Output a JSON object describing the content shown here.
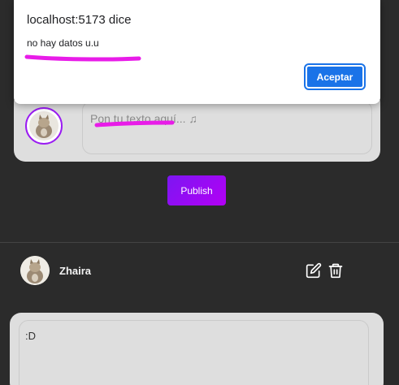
{
  "dialog": {
    "title": "localhost:5173 dice",
    "message": "no hay datos u.u",
    "ok_label": "Aceptar"
  },
  "composer": {
    "placeholder": "Pon tu texto aquí... ♫"
  },
  "publish_label": "Publish",
  "post": {
    "username": "Zhaira",
    "content": ":D"
  },
  "colors": {
    "background": "#2b2b2b",
    "card": "#dedede",
    "accent": "#9a1cf2",
    "dialog_button": "#1a73e8",
    "highlight": "#e81ce8"
  }
}
